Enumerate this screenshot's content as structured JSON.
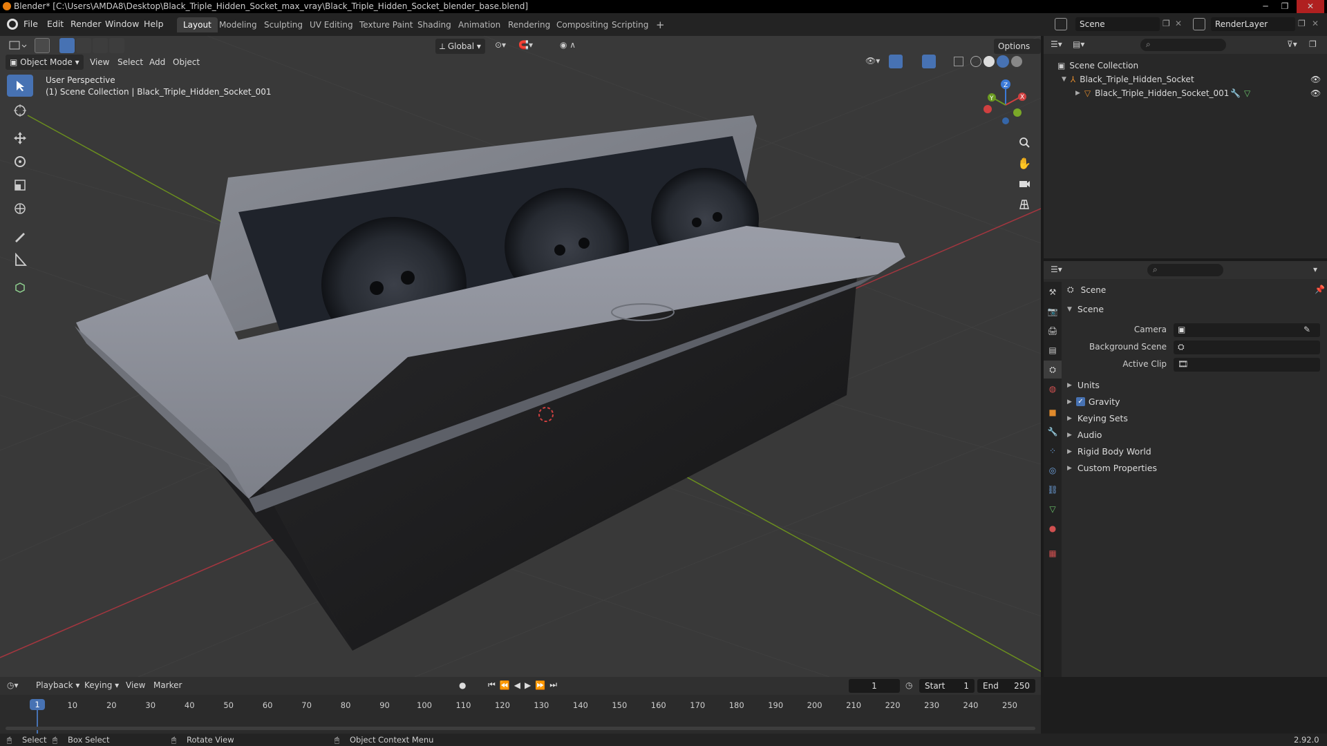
{
  "window": {
    "title": "Blender* [C:\\Users\\AMDA8\\Desktop\\Black_Triple_Hidden_Socket_max_vray\\Black_Triple_Hidden_Socket_blender_base.blend]",
    "controls": [
      "─",
      "❐",
      "✕"
    ]
  },
  "menu": [
    "File",
    "Edit",
    "Render",
    "Window",
    "Help"
  ],
  "workspaces": [
    {
      "label": "Layout",
      "active": true
    },
    {
      "label": "Modeling"
    },
    {
      "label": "Sculpting"
    },
    {
      "label": "UV Editing"
    },
    {
      "label": "Texture Paint"
    },
    {
      "label": "Shading"
    },
    {
      "label": "Animation"
    },
    {
      "label": "Rendering"
    },
    {
      "label": "Compositing"
    },
    {
      "label": "Scripting"
    },
    {
      "label": "+"
    }
  ],
  "scene_selector": {
    "value": "Scene"
  },
  "view_layer_selector": {
    "value": "RenderLayer"
  },
  "viewport": {
    "transform_orientation": "Global",
    "options_label": "Options",
    "mode": "Object Mode",
    "menus": [
      "View",
      "Select",
      "Add",
      "Object"
    ],
    "overlay_text_line1": "User Perspective",
    "overlay_text_line2": "(1) Scene Collection | Black_Triple_Hidden_Socket_001",
    "gizmo": {
      "x": "X",
      "y": "Y",
      "z": "Z"
    },
    "colors": {
      "background": "#393939",
      "grid": "#444444",
      "x_axis": "#a3363f",
      "y_axis": "#6b8f1e",
      "selection": "#4772b3"
    }
  },
  "outliner": {
    "root": "Scene Collection",
    "items": [
      {
        "label": "Black_Triple_Hidden_Socket",
        "icon": "empty-axes-icon"
      },
      {
        "label": "Black_Triple_Hidden_Socket_001",
        "icon": "mesh-icon"
      }
    ]
  },
  "properties": {
    "context": "Scene",
    "panel_title": "Scene",
    "fields": [
      {
        "label": "Camera",
        "value": ""
      },
      {
        "label": "Background Scene",
        "value": ""
      },
      {
        "label": "Active Clip",
        "value": ""
      }
    ],
    "panels": [
      {
        "label": "Units",
        "checkbox": false
      },
      {
        "label": "Gravity",
        "checkbox": true,
        "checked": true
      },
      {
        "label": "Keying Sets",
        "checkbox": false
      },
      {
        "label": "Audio",
        "checkbox": false
      },
      {
        "label": "Rigid Body World",
        "checkbox": false
      },
      {
        "label": "Custom Properties",
        "checkbox": false
      }
    ]
  },
  "timeline": {
    "menus": [
      "Playback",
      "Keying",
      "View",
      "Marker"
    ],
    "current_frame": "1",
    "start_label": "Start",
    "start_value": "1",
    "end_label": "End",
    "end_value": "250",
    "ticks": [
      "1",
      "10",
      "20",
      "30",
      "40",
      "50",
      "60",
      "70",
      "80",
      "90",
      "100",
      "110",
      "120",
      "130",
      "140",
      "150",
      "160",
      "170",
      "180",
      "190",
      "200",
      "210",
      "220",
      "230",
      "240",
      "250"
    ]
  },
  "statusbar": {
    "items": [
      "Select",
      "Box Select",
      "Rotate View",
      "Object Context Menu"
    ],
    "version": "2.92.0"
  }
}
